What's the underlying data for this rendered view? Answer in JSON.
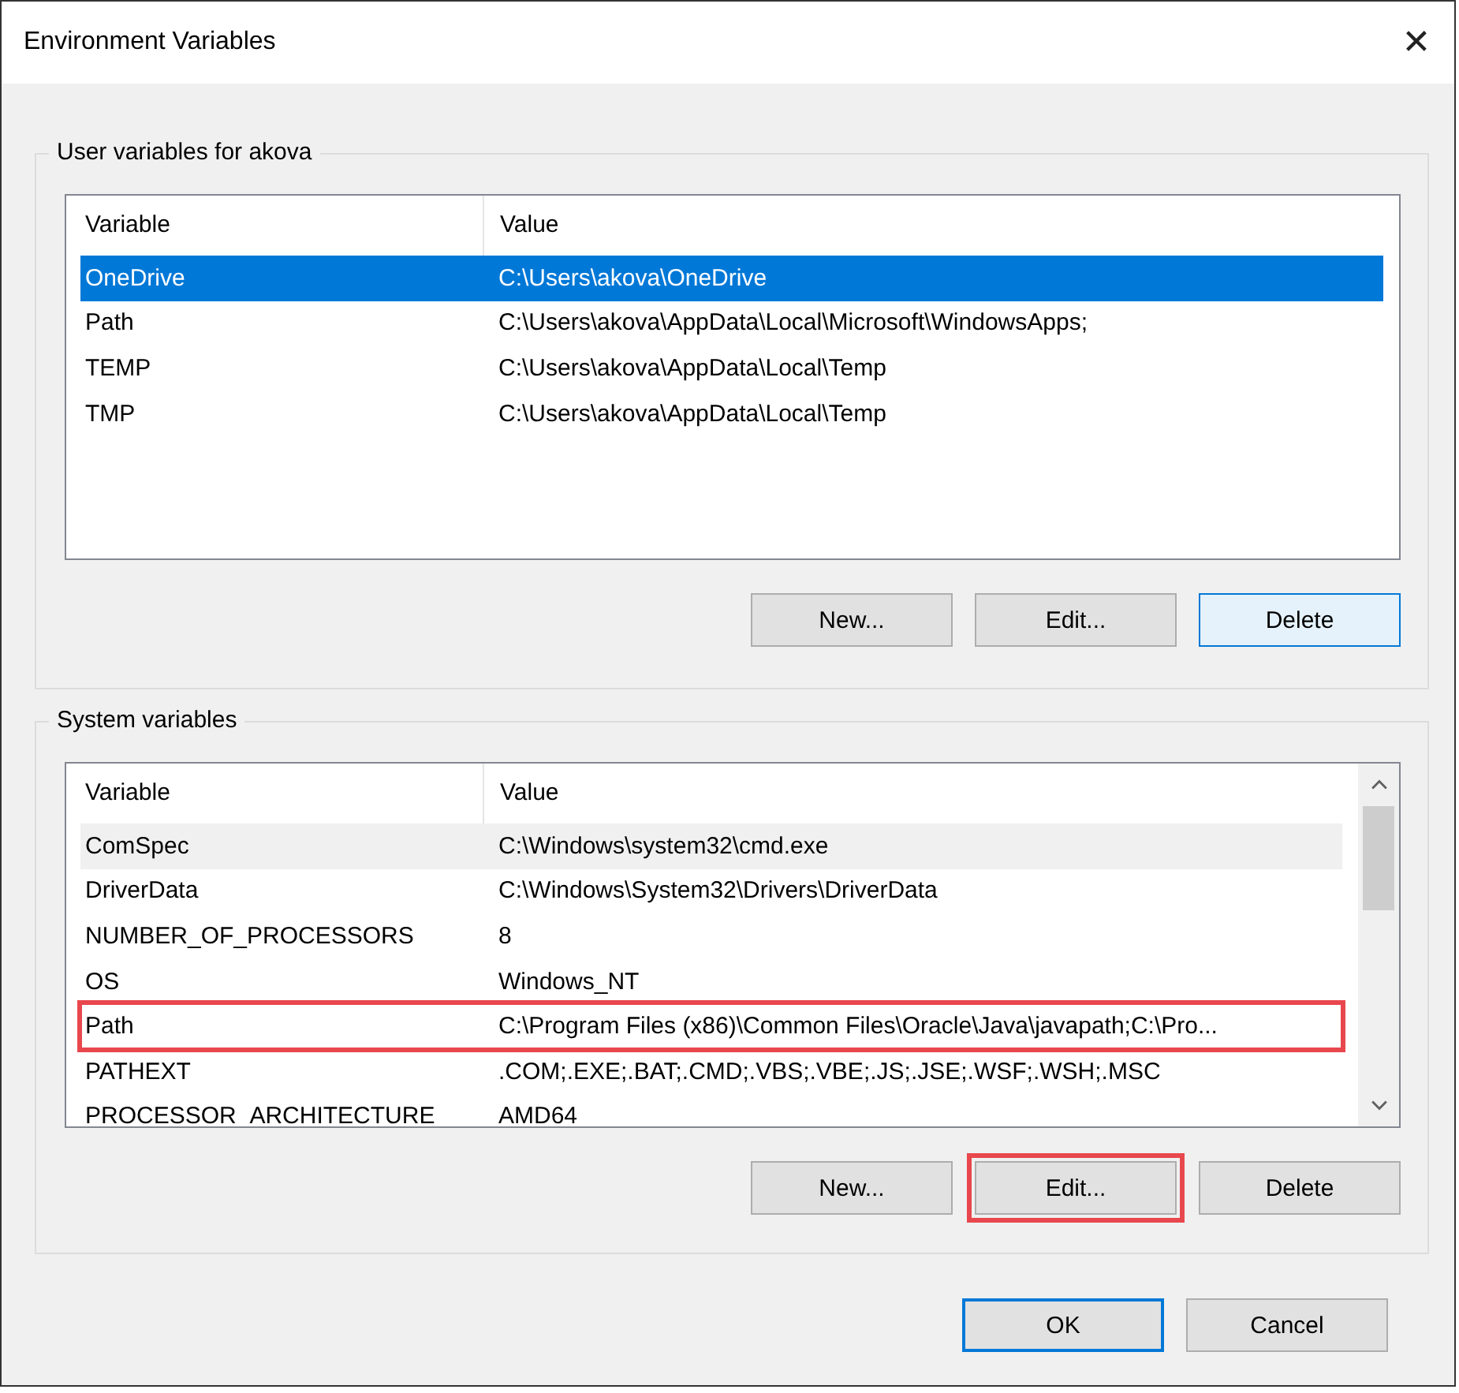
{
  "window": {
    "title": "Environment Variables",
    "close": "✕"
  },
  "user_section": {
    "title": "User variables for akova",
    "columns": [
      "Variable",
      "Value"
    ],
    "rows": [
      {
        "variable": "OneDrive",
        "value": "C:\\Users\\akova\\OneDrive",
        "selected": true,
        "hovered": false,
        "marked": false
      },
      {
        "variable": "Path",
        "value": "C:\\Users\\akova\\AppData\\Local\\Microsoft\\WindowsApps;",
        "selected": false,
        "hovered": false,
        "marked": false
      },
      {
        "variable": "TEMP",
        "value": "C:\\Users\\akova\\AppData\\Local\\Temp",
        "selected": false,
        "hovered": false,
        "marked": false
      },
      {
        "variable": "TMP",
        "value": "C:\\Users\\akova\\AppData\\Local\\Temp",
        "selected": false,
        "hovered": false,
        "marked": false
      }
    ],
    "buttons": [
      {
        "label": "New...",
        "hovered": false,
        "marked": false
      },
      {
        "label": "Edit...",
        "hovered": false,
        "marked": false
      },
      {
        "label": "Delete",
        "hovered": true,
        "marked": false
      }
    ]
  },
  "system_section": {
    "title": "System variables",
    "columns": [
      "Variable",
      "Value"
    ],
    "rows": [
      {
        "variable": "ComSpec",
        "value": "C:\\Windows\\system32\\cmd.exe",
        "selected": false,
        "hovered": true,
        "marked": false
      },
      {
        "variable": "DriverData",
        "value": "C:\\Windows\\System32\\Drivers\\DriverData",
        "selected": false,
        "hovered": false,
        "marked": false
      },
      {
        "variable": "NUMBER_OF_PROCESSORS",
        "value": "8",
        "selected": false,
        "hovered": false,
        "marked": false
      },
      {
        "variable": "OS",
        "value": "Windows_NT",
        "selected": false,
        "hovered": false,
        "marked": false
      },
      {
        "variable": "Path",
        "value": "C:\\Program Files (x86)\\Common Files\\Oracle\\Java\\javapath;C:\\Pro...",
        "selected": false,
        "hovered": false,
        "marked": true
      },
      {
        "variable": "PATHEXT",
        "value": ".COM;.EXE;.BAT;.CMD;.VBS;.VBE;.JS;.JSE;.WSF;.WSH;.MSC",
        "selected": false,
        "hovered": false,
        "marked": false
      },
      {
        "variable": "PROCESSOR_ARCHITECTURE",
        "value": "AMD64",
        "selected": false,
        "hovered": false,
        "marked": false
      }
    ],
    "buttons": [
      {
        "label": "New...",
        "hovered": false,
        "marked": false
      },
      {
        "label": "Edit...",
        "hovered": false,
        "marked": true
      },
      {
        "label": "Delete",
        "hovered": false,
        "marked": false
      }
    ]
  },
  "dialog_buttons": [
    {
      "label": "OK",
      "default": true
    },
    {
      "label": "Cancel",
      "default": false
    }
  ]
}
